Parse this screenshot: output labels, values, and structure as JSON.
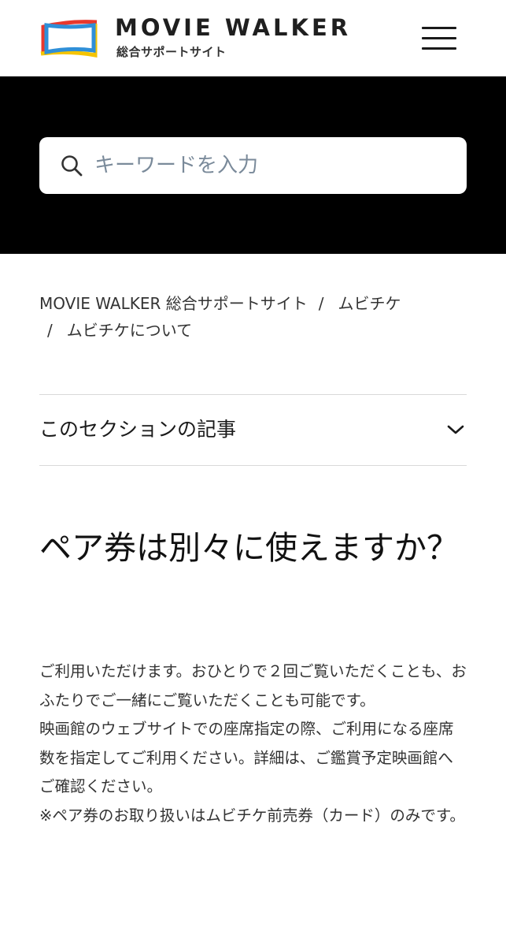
{
  "header": {
    "brand_name": "MOVIE WALKER",
    "brand_sub": "総合サポートサイト",
    "logo_colors": [
      "#f5c400",
      "#2f8fd8",
      "#e8382d"
    ]
  },
  "search": {
    "placeholder": "キーワードを入力"
  },
  "breadcrumb": {
    "items": [
      "MOVIE WALKER 総合サポートサイト",
      "ムビチケ",
      "ムビチケについて"
    ],
    "separator": "/"
  },
  "section_toggle": {
    "label": "このセクションの記事"
  },
  "article": {
    "title": "ペア券は別々に使えますか？",
    "body": "ご利用いただけます。おひとりで２回ご覧いただくことも、おふたりでご一緒にご覧いただくことも可能です。\n映画館のウェブサイトでの座席指定の際、ご利用になる座席数を指定してご利用ください。詳細は、ご鑑賞予定映画館へご確認ください。\n※ペア券のお取り扱いはムビチケ前売券（カード）のみです。"
  }
}
